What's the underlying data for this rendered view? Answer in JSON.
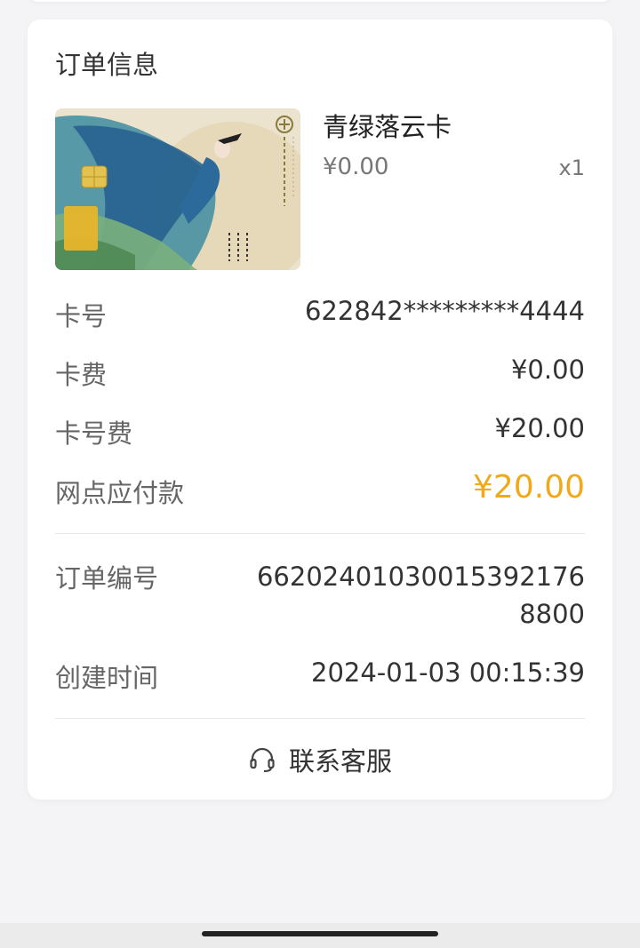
{
  "order": {
    "section_title": "订单信息",
    "product": {
      "name": "青绿落云卡",
      "price": "¥0.00",
      "quantity": "x1",
      "image_icon": "bank-card-image"
    },
    "details": [
      {
        "label": "卡号",
        "value": "622842*********4444"
      },
      {
        "label": "卡费",
        "value": "¥0.00"
      },
      {
        "label": "卡号费",
        "value": "¥20.00"
      },
      {
        "label": "网点应付款",
        "value": "¥20.00"
      }
    ],
    "order_number": {
      "label": "订单编号",
      "value": "662024010300153921768800"
    },
    "created_time": {
      "label": "创建时间",
      "value": "2024-01-03 00:15:39"
    },
    "contact": {
      "label": "联系客服",
      "icon": "headset-icon"
    }
  },
  "colors": {
    "accent": "#f0a91b",
    "page_background": "#f4f4f6",
    "card_background": "#ffffff"
  }
}
